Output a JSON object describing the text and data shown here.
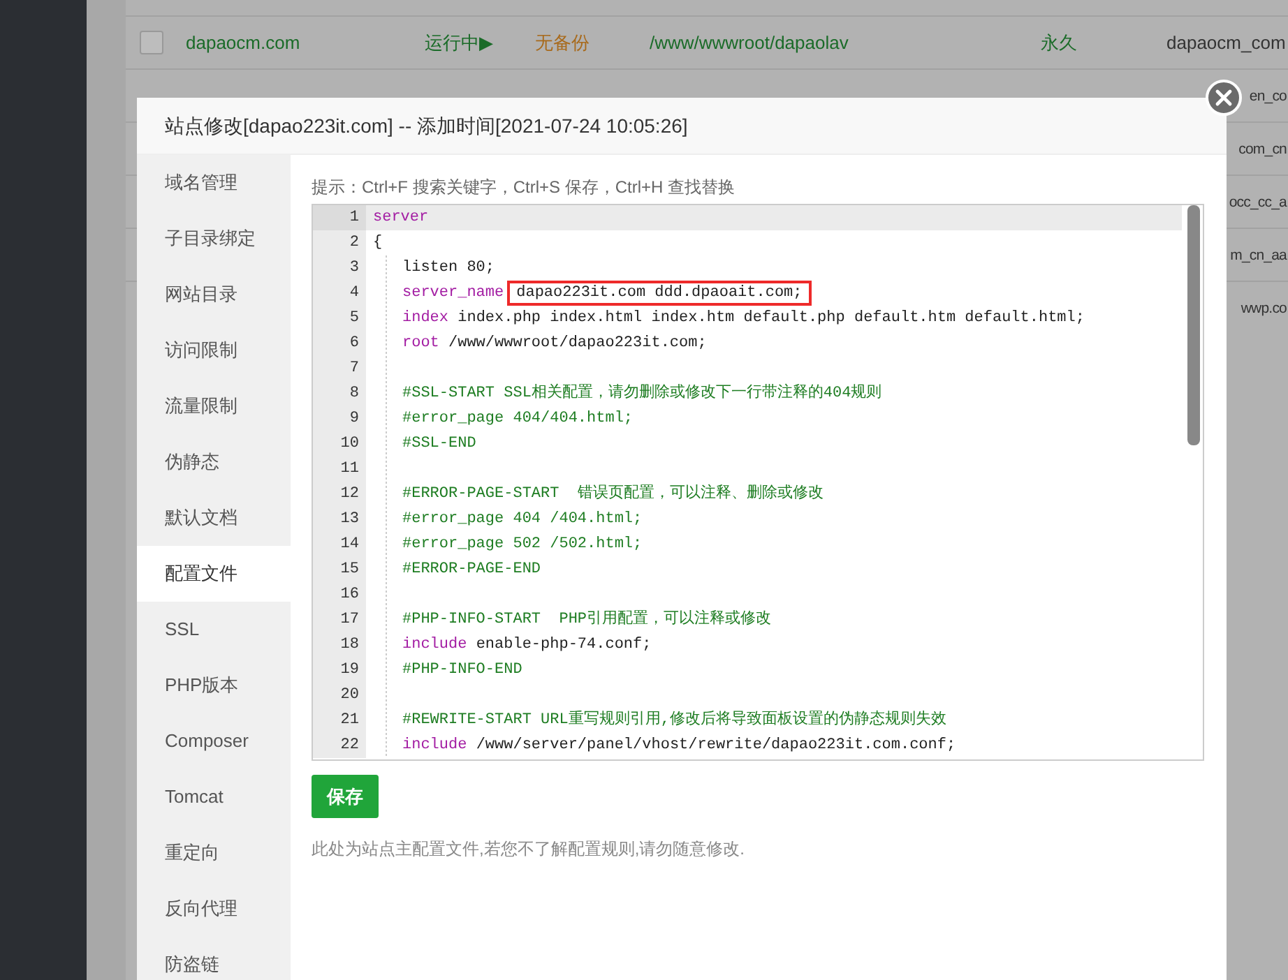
{
  "background_table": {
    "rows": [
      {
        "kind": "full",
        "checked": false,
        "name": "dapaocm.com",
        "status": "运行中▶",
        "backup": "无备份",
        "path": "/www/wwwroot/dapaolav",
        "expiry": "永久",
        "column_6": "dapaocm_com"
      },
      {
        "kind": "edge",
        "column_6": "en_co"
      },
      {
        "kind": "edge",
        "column_6": "com_cn"
      },
      {
        "kind": "edge",
        "column_6": "occ_cc_a"
      },
      {
        "kind": "edge",
        "column_6": "m_cn_aa"
      },
      {
        "kind": "edge",
        "column_6": "wwp.co"
      }
    ]
  },
  "dialog": {
    "title": "站点修改[dapao223it.com] -- 添加时间[2021-07-24 10:05:26]",
    "sidebar": {
      "items": [
        {
          "label": "域名管理",
          "selected": false
        },
        {
          "label": "子目录绑定",
          "selected": false
        },
        {
          "label": "网站目录",
          "selected": false
        },
        {
          "label": "访问限制",
          "selected": false
        },
        {
          "label": "流量限制",
          "selected": false
        },
        {
          "label": "伪静态",
          "selected": false
        },
        {
          "label": "默认文档",
          "selected": false
        },
        {
          "label": "配置文件",
          "selected": true
        },
        {
          "label": "SSL",
          "selected": false
        },
        {
          "label": "PHP版本",
          "selected": false
        },
        {
          "label": "Composer",
          "selected": false
        },
        {
          "label": "Tomcat",
          "selected": false
        },
        {
          "label": "重定向",
          "selected": false
        },
        {
          "label": "反向代理",
          "selected": false
        },
        {
          "label": "防盗链",
          "selected": false
        }
      ]
    },
    "hint": "提示：Ctrl+F 搜索关键字，Ctrl+S 保存，Ctrl+H 查找替换",
    "editor": {
      "lines": [
        {
          "number": "1",
          "active": true,
          "indented": false,
          "tokens": [
            {
              "kind": "keyword",
              "text": "server"
            }
          ]
        },
        {
          "number": "2",
          "active": false,
          "indented": false,
          "tokens": [
            {
              "kind": "plain",
              "text": "{"
            }
          ]
        },
        {
          "number": "3",
          "active": false,
          "indented": true,
          "tokens": [
            {
              "kind": "plain",
              "text": "listen 80;"
            }
          ]
        },
        {
          "number": "4",
          "active": false,
          "indented": true,
          "tokens": [
            {
              "kind": "keyword",
              "text": "server_name"
            },
            {
              "kind": "boxed",
              "text": "dapao223it.com ddd.dpaoait.com;"
            }
          ]
        },
        {
          "number": "5",
          "active": false,
          "indented": true,
          "tokens": [
            {
              "kind": "keyword",
              "text": "index"
            },
            {
              "kind": "plain",
              "text": " index.php index.html index.htm default.php default.htm default.html;"
            }
          ]
        },
        {
          "number": "6",
          "active": false,
          "indented": true,
          "tokens": [
            {
              "kind": "keyword",
              "text": "root"
            },
            {
              "kind": "plain",
              "text": " /www/wwwroot/dapao223it.com;"
            }
          ]
        },
        {
          "number": "7",
          "active": false,
          "indented": true
        },
        {
          "number": "8",
          "active": false,
          "indented": true,
          "tokens": [
            {
              "kind": "comment",
              "text": "#SSL-START SSL相关配置，请勿删除或修改下一行带注释的404规则"
            }
          ]
        },
        {
          "number": "9",
          "active": false,
          "indented": true,
          "tokens": [
            {
              "kind": "comment",
              "text": "#error_page 404/404.html;"
            }
          ]
        },
        {
          "number": "10",
          "active": false,
          "indented": true,
          "tokens": [
            {
              "kind": "comment",
              "text": "#SSL-END"
            }
          ]
        },
        {
          "number": "11",
          "active": false,
          "indented": true
        },
        {
          "number": "12",
          "active": false,
          "indented": true,
          "tokens": [
            {
              "kind": "comment",
              "text": "#ERROR-PAGE-START  错误页配置，可以注释、删除或修改"
            }
          ]
        },
        {
          "number": "13",
          "active": false,
          "indented": true,
          "tokens": [
            {
              "kind": "comment",
              "text": "#error_page 404 /404.html;"
            }
          ]
        },
        {
          "number": "14",
          "active": false,
          "indented": true,
          "tokens": [
            {
              "kind": "comment",
              "text": "#error_page 502 /502.html;"
            }
          ]
        },
        {
          "number": "15",
          "active": false,
          "indented": true,
          "tokens": [
            {
              "kind": "comment",
              "text": "#ERROR-PAGE-END"
            }
          ]
        },
        {
          "number": "16",
          "active": false,
          "indented": true
        },
        {
          "number": "17",
          "active": false,
          "indented": true,
          "tokens": [
            {
              "kind": "comment",
              "text": "#PHP-INFO-START  PHP引用配置，可以注释或修改"
            }
          ]
        },
        {
          "number": "18",
          "active": false,
          "indented": true,
          "tokens": [
            {
              "kind": "keyword",
              "text": "include"
            },
            {
              "kind": "plain",
              "text": " enable-php-74.conf;"
            }
          ]
        },
        {
          "number": "19",
          "active": false,
          "indented": true,
          "tokens": [
            {
              "kind": "comment",
              "text": "#PHP-INFO-END"
            }
          ]
        },
        {
          "number": "20",
          "active": false,
          "indented": true
        },
        {
          "number": "21",
          "active": false,
          "indented": true,
          "tokens": [
            {
              "kind": "comment",
              "text": "#REWRITE-START URL重写规则引用,修改后将导致面板设置的伪静态规则失效"
            }
          ]
        },
        {
          "number": "22",
          "active": false,
          "indented": true,
          "tokens": [
            {
              "kind": "keyword",
              "text": "include"
            },
            {
              "kind": "plain",
              "text": " /www/server/panel/vhost/rewrite/dapao223it.com.conf;"
            }
          ]
        }
      ]
    },
    "save_button": "保存",
    "note": "此处为站点主配置文件,若您不了解配置规则,请勿随意修改."
  }
}
